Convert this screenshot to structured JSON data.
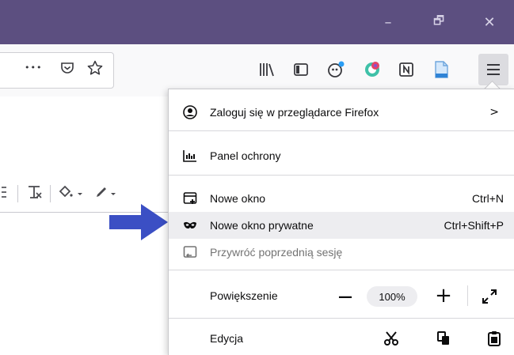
{
  "window_controls": {
    "minimize_glyph": "–",
    "restore_glyph": "🗗",
    "close_glyph": "✕"
  },
  "toolbar": {
    "overflow_glyph": "•••"
  },
  "menu": {
    "sign_in": {
      "label": "Zaloguj się w przeglądarce Firefox",
      "chevron": ">"
    },
    "protection": {
      "label": "Panel ochrony"
    },
    "new_window": {
      "label": "Nowe okno",
      "shortcut": "Ctrl+N"
    },
    "private_window": {
      "label": "Nowe okno prywatne",
      "shortcut": "Ctrl+Shift+P"
    },
    "restore_session": {
      "label": "Przywróć poprzednią sesję"
    },
    "zoom": {
      "label": "Powiększenie",
      "minus": "—",
      "value": "100%",
      "plus": "+"
    },
    "edit": {
      "label": "Edycja"
    }
  },
  "colors": {
    "titlebar": "#5c4f80",
    "arrow": "#3b4fc4",
    "highlight": "#ededf0"
  }
}
